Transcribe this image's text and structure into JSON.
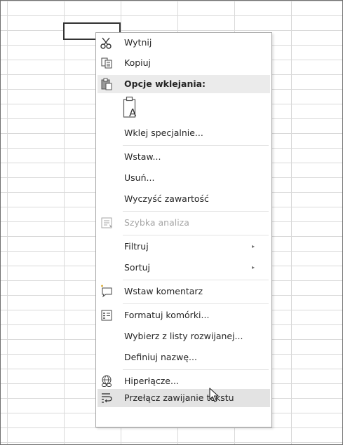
{
  "context_menu": {
    "cut": "Wytnij",
    "copy": "Kopiuj",
    "paste_options_header": "Opcje wklejania:",
    "paste_special": "Wklej specjalnie...",
    "insert": "Wstaw...",
    "delete": "Usuń...",
    "clear_contents": "Wyczyść zawartość",
    "quick_analysis": "Szybka analiza",
    "filter": "Filtruj",
    "sort": "Sortuj",
    "insert_comment": "Wstaw komentarz",
    "format_cells": "Formatuj komórki...",
    "pick_from_dropdown": "Wybierz z listy rozwijanej...",
    "define_name": "Definiuj nazwę...",
    "hyperlink": "Hiperłącze...",
    "wrap_text": "Przełącz zawijanie tekstu",
    "submenu_arrow": "▸",
    "paste_icon_letter": "A"
  },
  "icons": {
    "cut": "scissors-icon",
    "copy": "copy-icon",
    "paste_options": "clipboard-icon",
    "paste_values": "paste-text-icon",
    "quick_analysis": "quick-analysis-icon",
    "insert_comment": "comment-icon",
    "format_cells": "format-cells-icon",
    "hyperlink": "hyperlink-icon",
    "wrap_text": "wrap-text-icon",
    "cursor": "mouse-pointer-icon"
  },
  "colors": {
    "hover_background": "#e3e3e3",
    "header_background": "#ebebeb",
    "gridline": "#d9d9d9",
    "disabled_text": "#a6a6a6"
  }
}
